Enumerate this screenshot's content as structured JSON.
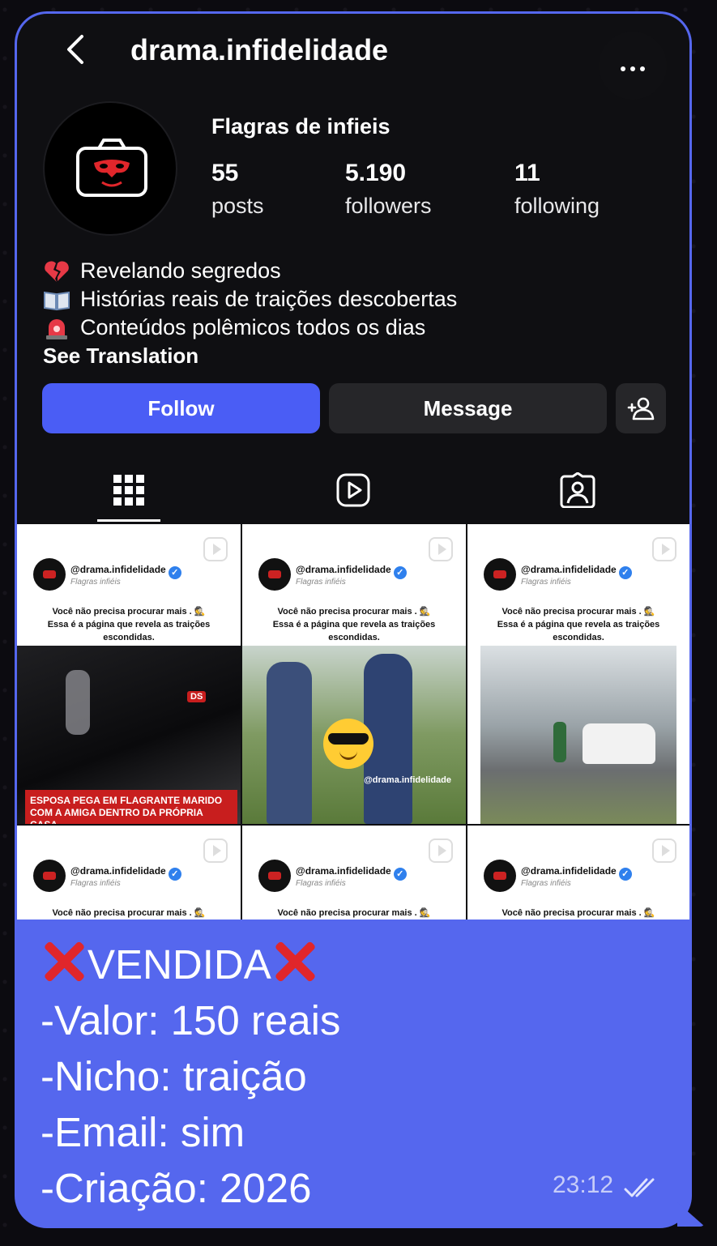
{
  "profile": {
    "username": "drama.infidelidade",
    "display_name": "Flagras de infieis",
    "stats": {
      "posts": {
        "value": "55",
        "label": "posts"
      },
      "followers": {
        "value": "5.190",
        "label": "followers"
      },
      "following": {
        "value": "11",
        "label": "following"
      }
    },
    "bio": [
      {
        "icon": "broken-heart-icon",
        "text": "Revelando segredos"
      },
      {
        "icon": "open-book-icon",
        "text": "Histórias reais de traições descobertas"
      },
      {
        "icon": "siren-icon",
        "text": "Conteúdos polêmicos todos os dias"
      }
    ],
    "see_translation": "See Translation"
  },
  "actions": {
    "follow": "Follow",
    "message": "Message"
  },
  "grid": {
    "handle": "@drama.infidelidade",
    "subtitle": "Flagras infiéis",
    "tagline": "Você não precisa procurar mais . 🕵\nEssa é a página que revela as traições escondidas.",
    "tagline_short": "Você não precisa procurar mais . 🕵",
    "post1_badge": "DS",
    "post1_caption": "ESPOSA PEGA EM FLAGRANTE MARIDO COM A AMIGA DENTRO DA PRÓPRIA CASA",
    "post2_watermark": "@drama.infidelidade"
  },
  "message": {
    "line1_word": "VENDIDA",
    "line2": "-Valor: 150 reais",
    "line3": "-Nicho: traição",
    "line4": "-Email: sim",
    "line5": "-Criação: 2026",
    "time": "23:12"
  },
  "colors": {
    "bubble": "#5567ee",
    "follow_button": "#4a5df5",
    "ig_background": "#0f0f12",
    "x_mark": "#e0262b"
  }
}
